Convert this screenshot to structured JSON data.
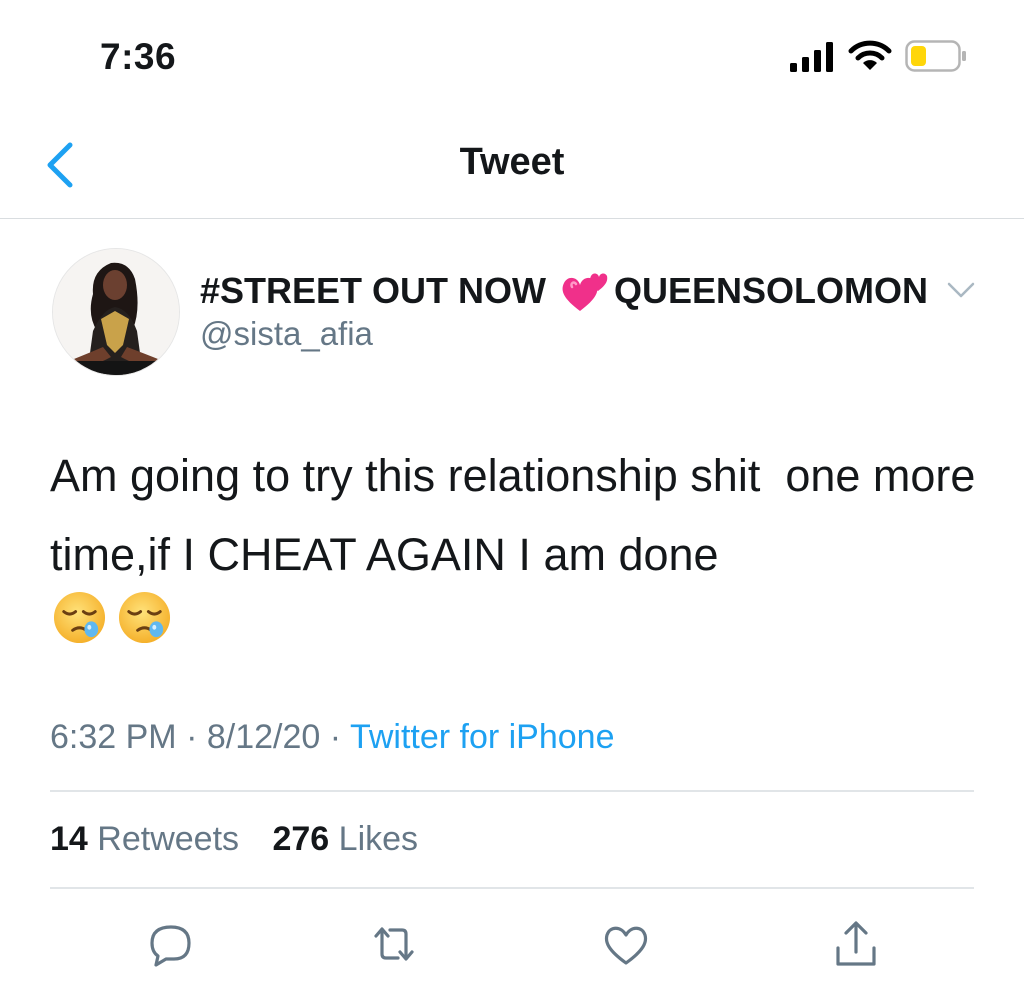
{
  "status_bar": {
    "time": "7:36",
    "icons": [
      "cellular-signal-icon",
      "wifi-icon",
      "battery-icon"
    ],
    "battery_color": "#ffd60a"
  },
  "nav": {
    "title": "Tweet",
    "back_icon": "chevron-left-icon",
    "accent": "#1da1f2"
  },
  "tweet": {
    "author": {
      "display_name_prefix": "#STREET OUT NOW",
      "display_name_emoji": "two-hearts-icon",
      "display_name_suffix": "QUEENSOLOMON",
      "handle": "@sista_afia"
    },
    "text": "Am going to try this relationship shit  one more time,if I CHEAT AGAIN I am done",
    "trailing_emoji": [
      "sleepy-face-icon",
      "sleepy-face-icon"
    ],
    "time": "6:32 PM",
    "date": "8/12/20",
    "separator": "·",
    "source": "Twitter for iPhone",
    "retweets": {
      "count": "14",
      "label": "Retweets"
    },
    "likes": {
      "count": "276",
      "label": "Likes"
    }
  },
  "actions": [
    "reply-icon",
    "retweet-icon",
    "like-icon",
    "share-icon"
  ],
  "colors": {
    "text": "#14171a",
    "secondary": "#657786",
    "link": "#1da1f2",
    "icon": "#657786"
  }
}
